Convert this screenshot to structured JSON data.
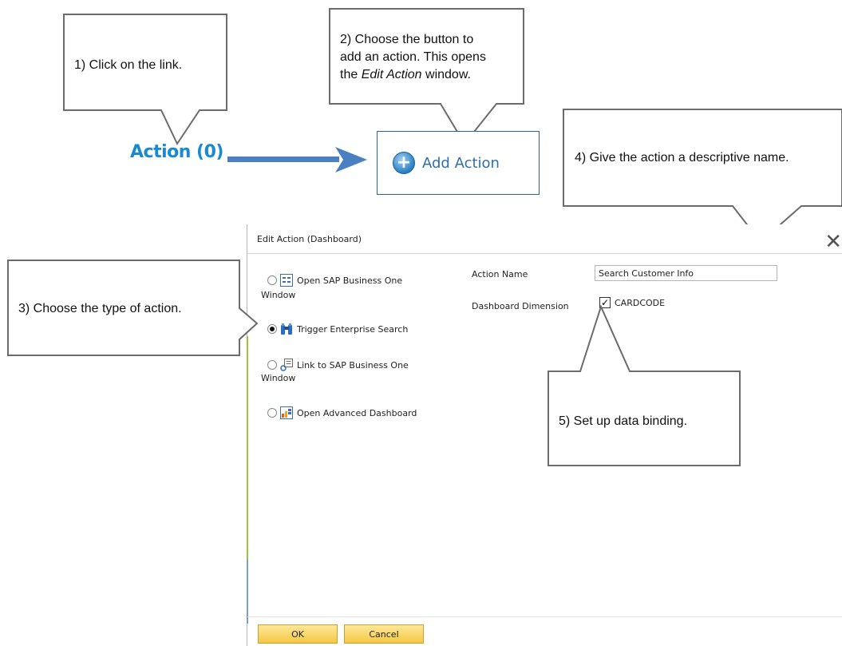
{
  "callouts": {
    "step1": "1) Click on the link.",
    "step2_line1": "2) Choose the button to",
    "step2_line2": "add an action. This opens",
    "step2_line3_pre": "the ",
    "step2_line3_em": "Edit Action",
    "step2_line3_post": " window.",
    "step3": "3) Choose the type of action.",
    "step4": "4) Give the action a descriptive name.",
    "step5": "5) Set up data binding."
  },
  "link": {
    "label": "Action (0)"
  },
  "add_button": {
    "label": "Add Action"
  },
  "dialog": {
    "title": "Edit Action (Dashboard)",
    "close_icon": "close-icon",
    "options": [
      {
        "line1": "Open SAP Business One",
        "line2": "Window",
        "icon": "window-icon",
        "selected": false
      },
      {
        "line1": "Trigger Enterprise Search",
        "line2": "",
        "icon": "binoculars-icon",
        "selected": true
      },
      {
        "line1": "Link to SAP Business One",
        "line2": "Window",
        "icon": "link-window-icon",
        "selected": false
      },
      {
        "line1": "Open Advanced Dashboard",
        "line2": "",
        "icon": "dashboard-icon",
        "selected": false
      }
    ],
    "action_name_label": "Action Name",
    "action_name_value": "Search Customer Info",
    "dimension_label": "Dashboard Dimension",
    "dimension_checked": true,
    "dimension_value": "CARDCODE",
    "ok_label": "OK",
    "cancel_label": "Cancel"
  },
  "colors": {
    "link": "#1a8ad0",
    "arrow": "#4a7fc1",
    "button_yellow": "#f4c842",
    "accent_green": "#9bc43a"
  }
}
